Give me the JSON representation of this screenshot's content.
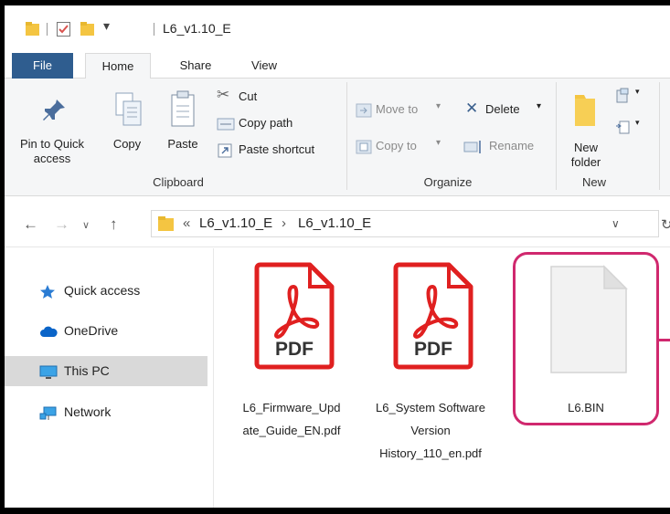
{
  "window": {
    "title": "L6_v1.10_E"
  },
  "tabs": {
    "file": "File",
    "home": "Home",
    "share": "Share",
    "view": "View"
  },
  "ribbon": {
    "clipboard": {
      "pin_label_1": "Pin to Quick",
      "pin_label_2": "access",
      "copy": "Copy",
      "paste": "Paste",
      "cut": "Cut",
      "copy_path": "Copy path",
      "paste_shortcut": "Paste shortcut",
      "group": "Clipboard"
    },
    "organize": {
      "move_to": "Move to",
      "copy_to": "Copy to",
      "delete": "Delete",
      "rename": "Rename",
      "group": "Organize"
    },
    "new": {
      "new_folder_1": "New",
      "new_folder_2": "folder",
      "group": "New"
    }
  },
  "address": {
    "overflow": "«",
    "crumb1": "L6_v1.10_E",
    "arrow": "›",
    "crumb2": "L6_v1.10_E"
  },
  "nav_pane": {
    "items": [
      {
        "label": "Quick access",
        "icon": "star-icon"
      },
      {
        "label": "OneDrive",
        "icon": "cloud-icon"
      },
      {
        "label": "This PC",
        "icon": "monitor-icon"
      },
      {
        "label": "Network",
        "icon": "network-icon"
      }
    ]
  },
  "files": [
    {
      "lines": [
        "L6_Firmware_Upd",
        "ate_Guide_EN.pdf"
      ],
      "type": "pdf",
      "badge": "PDF"
    },
    {
      "lines": [
        "L6_System Software",
        "Version",
        "History_110_en.pdf"
      ],
      "type": "pdf",
      "badge": "PDF"
    },
    {
      "lines": [
        "L6.BIN"
      ],
      "type": "blank"
    }
  ],
  "colors": {
    "file_tab": "#2f5d8f",
    "pdf_red": "#e02020",
    "highlight": "#d0286e",
    "selected_nav": "#d9d9d9"
  }
}
